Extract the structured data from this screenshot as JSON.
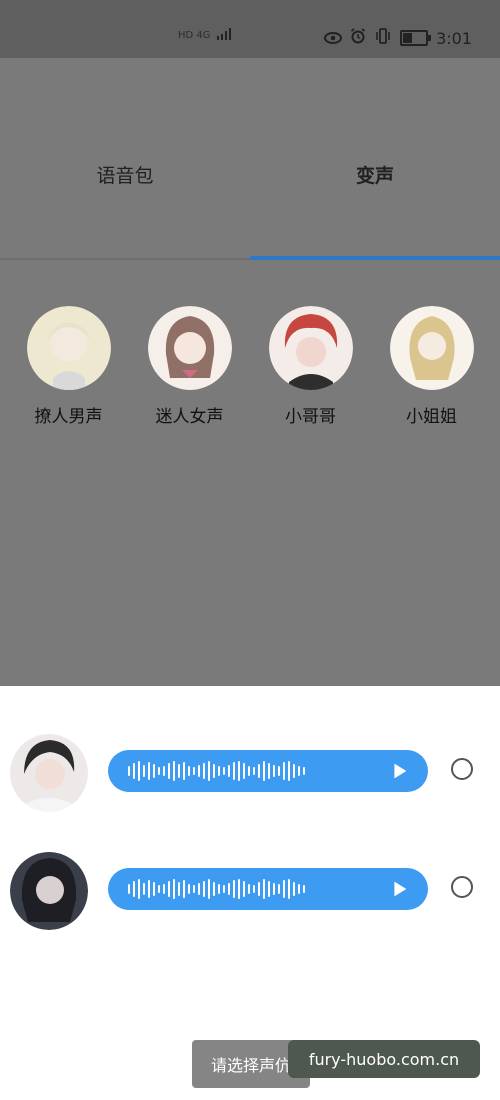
{
  "status_bar": {
    "network": "HD 4G",
    "time": "3:01",
    "battery_level": 0.45
  },
  "tabs": [
    {
      "label": "语音包"
    },
    {
      "label": "变声"
    }
  ],
  "voices": [
    {
      "label": "撩人男声"
    },
    {
      "label": "迷人女声"
    },
    {
      "label": "小哥哥"
    },
    {
      "label": "小姐姐"
    }
  ],
  "toast": {
    "text": "请选择声伉"
  },
  "watermark": {
    "text": "fury-huobo.com.cn"
  },
  "colors": {
    "accent_blue": "#3d9bf2",
    "tab_indicator": "#2f78c8",
    "overlay_gray": "#7a7a7a"
  }
}
